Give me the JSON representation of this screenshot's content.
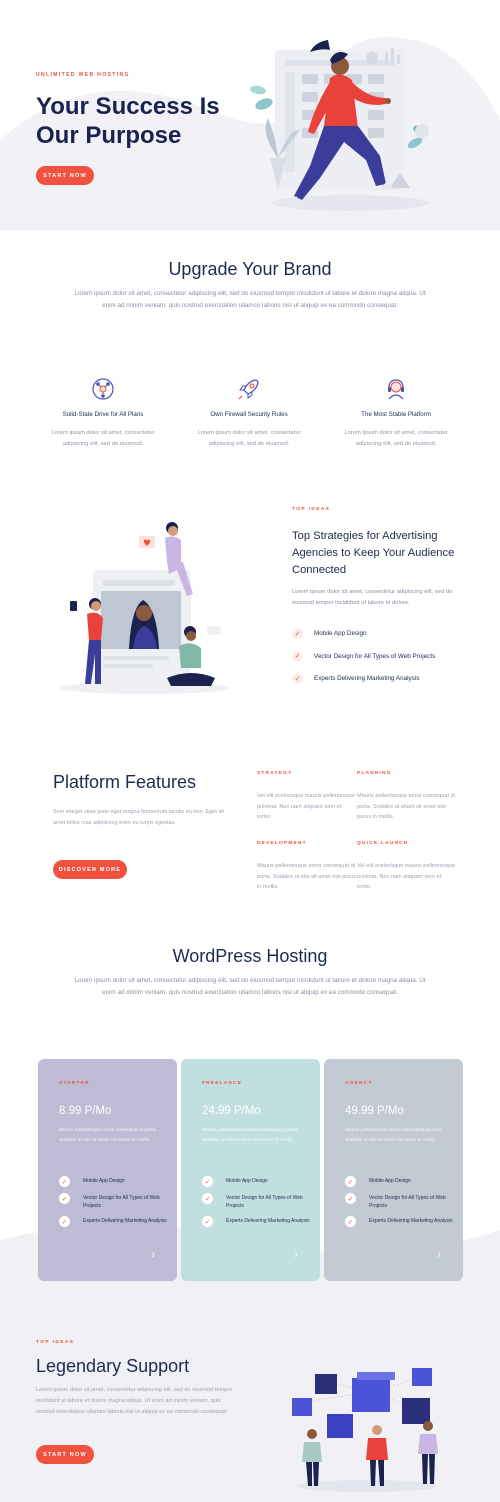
{
  "hero": {
    "eyebrow": "UNLIMITED WEB HOSTING",
    "title_line1": "Your Success Is",
    "title_line2": "Our Purpose",
    "button": "START NOW"
  },
  "upgrade": {
    "title": "Upgrade Your Brand",
    "body": "Lorem ipsum dolor sit amet, consectetur adipiscing elit, sed do eiusmod tempor incididunt ut labore et dolore magna aliqua. Ut enim ad minim veniam, quis nostrud exercitation ullamco laboris nisi ut aliquip ex ea commodo consequat."
  },
  "features": [
    {
      "icon": "network-icon",
      "title": "Solid-State Drive for All Plans",
      "body": "Lorem ipsum dolor sit amet, consectetur adipiscing elit, sed do eiusmod."
    },
    {
      "icon": "rocket-icon",
      "title": "Own Firewall Security Rules",
      "body": "Lorem ipsum dolor sit amet, consectetur adipiscing elit, sed do eiusmod."
    },
    {
      "icon": "headset-icon",
      "title": "The Most Stable Platform",
      "body": "Lorem ipsum dolor sit amet, consectetur adipiscing elit, sed do eiusmod."
    }
  ],
  "strategies": {
    "eyebrow": "TOP IDEAS",
    "title_line1": "Top Strategies for Advertising",
    "title_line2": "Agencies to Keep Your Audience",
    "title_line3": "Connected",
    "body": "Lorem ipsum dolor sit amet, consectetur adipiscing elit, sed do eiusmod tempor incididunt ut labore et dolore.",
    "checks": [
      "Mobile App Design",
      "Vector Design for All Types of Web Projects",
      "Experts Delivering Marketing Analysis"
    ]
  },
  "platform": {
    "title": "Platform Features",
    "body": "Sem integer vitae justo eget magna fermentum iaculis eu non. Eget sit amet tellus cras adipiscing enim eu turpis egestas.",
    "button": "DISCOVER MORE",
    "items": [
      {
        "label": "STRATEGY",
        "body": "Vel elit scelerisque mauris pellentesque pulvinar. Nec nam aliquam sem et tortor."
      },
      {
        "label": "PLANNING",
        "body": "Mauris pellentesque tortor consequat id porta. Sodales ut etiam sit amet nisl purus in mollis."
      },
      {
        "label": "DEVELOPMENT",
        "body": "Mauris pellentesque tortor consequat id porta. Sodales ut etis sit amet nisl purus in mollis."
      },
      {
        "label": "QUICK LAUNCH",
        "body": "Vel elit scelerisque mauris pellentesque pulvinar. Nec nam aliquam sem et tortor."
      }
    ]
  },
  "hosting": {
    "title": "WordPress Hosting",
    "body": "Lorem ipsum dolor sit amet, consectetur adipiscing elit, sed do eiusmod tempor incididunt ut labore et dolore magna aliqua. Ut enim ad minim veniam, quis nostrud exercitation ullamco laboris nisi ut aliquip ex ea commodo consequat."
  },
  "plans": [
    {
      "tier": "STARTER",
      "price": "8.99 P/Mo",
      "desc": "Mauris pellentesque tortor consequat id porta. Sodales ut etis sit amet nisl purus in mollis.",
      "bg": "#bdbcd4",
      "features": [
        "Mobile App Design",
        "Vector Design for All Types of Web Projects",
        "Experts Delivering Marketing Analysis"
      ]
    },
    {
      "tier": "FREELANCE",
      "price": "24.99 P/Mo",
      "desc": "Mauris pellentesque tortor consequat id porta. Sodales ut etis sit amet nisl purus in mollis.",
      "bg": "#c2dfe0",
      "features": [
        "Mobile App Design",
        "Vector Design for All Types of Web Projects",
        "Experts Delivering Marketing Analysis"
      ]
    },
    {
      "tier": "AGENCY",
      "price": "49.99 P/Mo",
      "desc": "Mauris pellentesque tortor consequat id porta. Sodales ut etis sit amet nisl purus in mollis.",
      "bg": "#c3cad3",
      "features": [
        "Mobile App Design",
        "Vector Design for All Types of Web Projects",
        "Experts Delivering Marketing Analysis"
      ]
    }
  ],
  "support": {
    "eyebrow": "TOP IDEAS",
    "title": "Legendary Support",
    "body": "Lorem ipsum dolor sit amet, consectetur adipiscing elit, sed do eiusmod tempor incididunt ut labore et dolore magna aliqua. Ut enim ad minim veniam, quis nostrud exercitation ullamco laboris nisi ut aliquip ex ea commodo consequat.",
    "button": "START NOW"
  },
  "colors": {
    "accent": "#f0523f",
    "navy": "#1d2b4f",
    "gray_bg": "#f1f1f5"
  }
}
